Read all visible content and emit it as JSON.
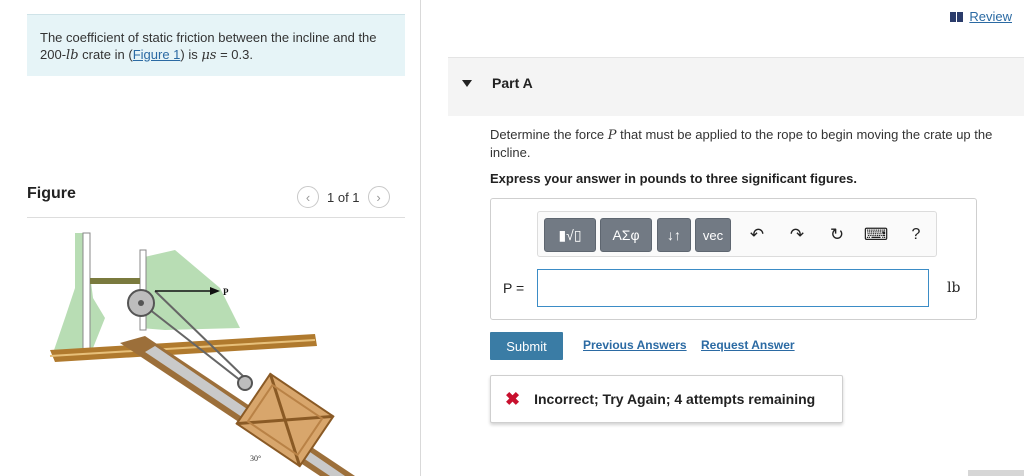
{
  "problem": {
    "text_before": "The coefficient of static friction between the incline and the 200-",
    "unit": "lb",
    "text_mid": " crate in (",
    "figure_link": "Figure 1",
    "text_after": ") is ",
    "mu_symbol": "μs",
    "mu_value": " = 0.3."
  },
  "figure": {
    "title": "Figure",
    "pager": "1 of 1",
    "force_label": "P",
    "angle_label": "30°"
  },
  "review_label": "Review",
  "part": {
    "title": "Part A",
    "question_before": "Determine the force ",
    "question_var": "P",
    "question_after": " that must be applied to the rope to begin moving the crate up the incline.",
    "instructions": "Express your answer in pounds to three significant figures."
  },
  "toolbar": {
    "templates_label": "▮√▯",
    "greek_label": "ΑΣφ",
    "arrows_label": "↓↑",
    "vec_label": "vec",
    "undo": "↶",
    "redo": "↷",
    "reset": "↻",
    "keyboard": "⌨",
    "help": "?"
  },
  "answer": {
    "label": "P =",
    "value": "",
    "unit": "lb"
  },
  "actions": {
    "submit": "Submit",
    "previous_answers": "Previous Answers",
    "request_answer": "Request Answer"
  },
  "feedback": {
    "message": "Incorrect; Try Again; 4 attempts remaining"
  },
  "colors": {
    "accent": "#3a7ca5",
    "link": "#2b6aa3",
    "error": "#c8102e",
    "problem_bg": "#e6f4f7"
  }
}
